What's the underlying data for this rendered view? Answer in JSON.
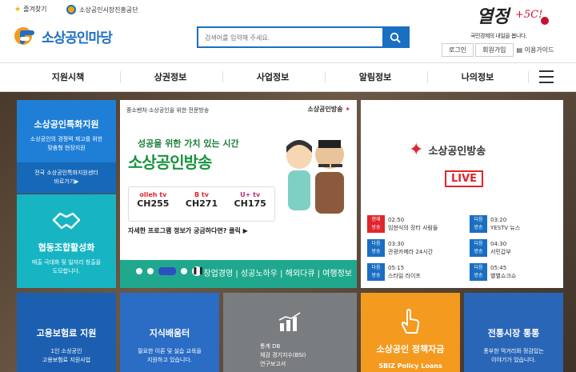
{
  "top": {
    "favorite": "즐겨찾기",
    "org": "소상공인시장진흥공단",
    "logo_text": "소상공인마당",
    "search_placeholder": "검색어를 입력해 주세요.",
    "slogan_sub": "국민경제의 내일을 봅니다.",
    "login": "로그인",
    "join": "회원가입",
    "guide": "이용가이드"
  },
  "gnb": [
    "지원시책",
    "상권정보",
    "사업정보",
    "알림정보",
    "나의정보"
  ],
  "tiles": {
    "t1": {
      "title": "소상공인특화지원",
      "desc1": "소상공인의 경쟁력 제고를 위한",
      "desc2": "맞춤형 현장지원",
      "sub1": "전국 소상공인특화지원센터",
      "sub2": "바로가기▶"
    },
    "t2": {
      "title": "협동조합활성화",
      "desc1": "매출 극대화 및 일자리 창출을",
      "desc2": "도모합니다."
    },
    "t3": {
      "title": "고용보험료 지원",
      "desc1": "1인 소상공인",
      "desc2": "고용보험료 지원사업"
    },
    "t4": {
      "title": "지식배움터",
      "desc1": "필요한 이론 및 실습 교육을",
      "desc2": "지원하고 있습니다."
    },
    "t5": {
      "l1": "통계 DB",
      "l2": "체감 경기지수(BSI)",
      "l3": "연구보고서"
    },
    "t6": {
      "title": "소상공인 정책자금",
      "sub": "SBIZ Policy Loans"
    },
    "t7": {
      "title": "전통시장 통통",
      "desc1": "풍부한 먹거리와 정감있는",
      "desc2": "이야기가 있습니다."
    }
  },
  "banner": {
    "top_small": "중소벤처·소상공인을 위한 전문방송",
    "brand": "소상공인방송",
    "tagline": "성공을 위한 가치 있는 시간",
    "headline": "소상공인방송",
    "channels": [
      {
        "name": "olleh tv",
        "ch": "CH255"
      },
      {
        "name": "B tv",
        "ch": "CH271"
      },
      {
        "name": "U+ tv",
        "ch": "CH175"
      }
    ],
    "more": "자세한 프로그램 정보가 궁금하다면? 클릭 ▶",
    "bottom": "창업경영 | 성공노하우 | 해외다큐 | 여행정보"
  },
  "live": {
    "brand": "소상공인방송",
    "live": "LIVE",
    "schedule": [
      {
        "tag": "현재\n방송",
        "time": "02:50",
        "title": "임현식의 장터 사람들",
        "current": true
      },
      {
        "tag": "다음\n방송",
        "time": "03:20",
        "title": "YESTV 뉴스"
      },
      {
        "tag": "다음\n방송",
        "time": "03:30",
        "title": "관광카메라 24시간"
      },
      {
        "tag": "다음\n방송",
        "time": "04:30",
        "title": "서민갑부"
      },
      {
        "tag": "다음\n방송",
        "time": "05:15",
        "title": "스타일 라이프"
      },
      {
        "tag": "다음\n방송",
        "time": "05:45",
        "title": "별별쇼크쇼"
      }
    ]
  },
  "colors": {
    "brand_blue": "#1a6fc2",
    "live_red": "#e0262c",
    "orange": "#f39a1f"
  }
}
